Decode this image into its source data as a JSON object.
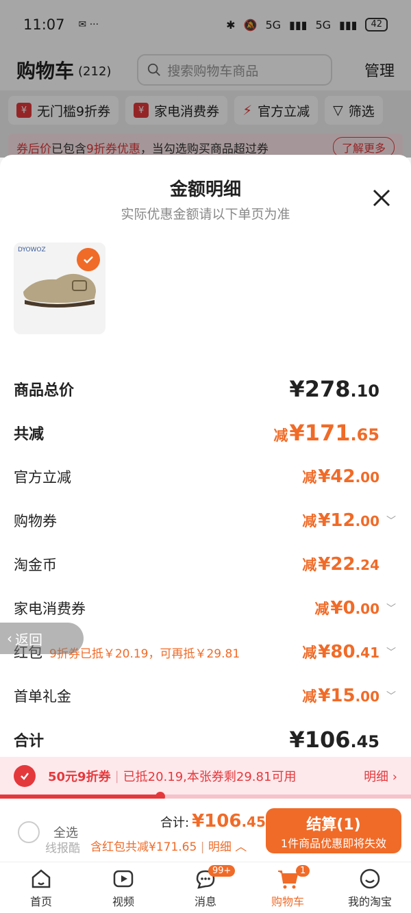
{
  "status_bar": {
    "time": "11:07",
    "network1": "5G",
    "network2": "5G",
    "battery": "42"
  },
  "cart": {
    "title": "购物车",
    "count": "(212)",
    "search_placeholder": "搜索购物车商品",
    "manage": "管理",
    "filters": [
      "无门槛9折券",
      "家电消费券",
      "官方立减",
      "筛选"
    ],
    "notice_prefix": "券后价",
    "notice_mid": "已包含",
    "notice_hl": "9折券优惠",
    "notice_rest": "，当勾选购买商品超过券",
    "notice_more": "了解更多"
  },
  "sheet": {
    "title": "金额明细",
    "subtitle": "实际优惠金额请以下单页为准",
    "product_brand": "DYOWOZ"
  },
  "rows": [
    {
      "label": "商品总价",
      "prefix": "",
      "int": "¥278",
      "dec": ".10",
      "bold": true,
      "style": "black"
    },
    {
      "label": "共减",
      "prefix": "减",
      "int": "¥171",
      "dec": ".65",
      "bold": true,
      "style": "red"
    },
    {
      "label": "官方立减",
      "prefix": "减",
      "int": "¥42",
      "dec": ".00",
      "style": "red"
    },
    {
      "label": "购物券",
      "prefix": "减",
      "int": "¥12",
      "dec": ".00",
      "style": "red"
    },
    {
      "label": "淘金币",
      "prefix": "减",
      "int": "¥22",
      "dec": ".24",
      "style": "red"
    },
    {
      "label": "家电消费券",
      "prefix": "减",
      "int": "¥0",
      "dec": ".00",
      "style": "red"
    },
    {
      "label": "红包",
      "prefix": "减",
      "int": "¥80",
      "dec": ".41",
      "style": "red",
      "note": "9折券已抵￥20.19，可再抵￥29.81"
    },
    {
      "label": "首单礼金",
      "prefix": "减",
      "int": "¥15",
      "dec": ".00",
      "style": "red"
    },
    {
      "label": "合计",
      "prefix": "",
      "int": "¥106",
      "dec": ".45",
      "bold": true,
      "style": "black"
    }
  ],
  "back_label": "返回",
  "coupon": {
    "title": "50元9折券",
    "desc": "已抵20.19,本张券剩29.81可用",
    "detail": "明细",
    "progress_fraction": 0.39
  },
  "checkout": {
    "select_all": "全选",
    "total_label": "合计:",
    "total_int": "¥106",
    "total_dec": ".45",
    "sub": "含红包共减¥171.65",
    "detail": "明细",
    "pay_label": "结算(1)",
    "pay_sub": "1件商品优惠即将失效",
    "watermark": "线报酷"
  },
  "tabs": [
    {
      "label": "首页",
      "icon": "home-icon"
    },
    {
      "label": "视频",
      "icon": "video-icon"
    },
    {
      "label": "消息",
      "icon": "message-icon",
      "badge": "99+"
    },
    {
      "label": "购物车",
      "icon": "cart-icon",
      "badge": "1",
      "active": true
    },
    {
      "label": "我的淘宝",
      "icon": "profile-icon"
    }
  ],
  "colors": {
    "accent": "#f06b28",
    "red": "#e4393c"
  }
}
